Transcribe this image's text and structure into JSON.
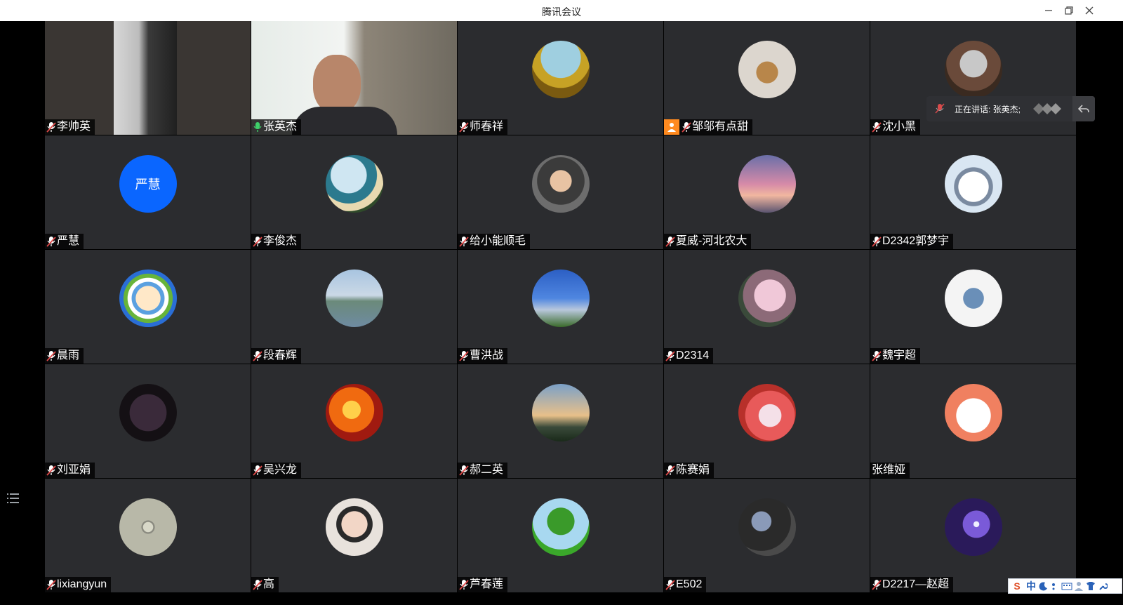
{
  "window": {
    "title": "腾讯会议",
    "controls": [
      "minimize-icon",
      "restore-icon",
      "close-icon"
    ]
  },
  "speaking_indicator": {
    "label": "正在讲话: 张英杰;"
  },
  "participants": [
    {
      "name": "李帅英",
      "mic": "muted",
      "kind": "video"
    },
    {
      "name": "张英杰",
      "mic": "active",
      "kind": "video"
    },
    {
      "name": "师春祥",
      "mic": "muted",
      "kind": "avatar"
    },
    {
      "name": "邹邬有点甜",
      "mic": "muted",
      "kind": "avatar",
      "host": true
    },
    {
      "name": "沈小黑",
      "mic": "muted",
      "kind": "avatar"
    },
    {
      "name": "严慧",
      "mic": "muted",
      "kind": "text-avatar",
      "avatar_text": "严慧"
    },
    {
      "name": "李俊杰",
      "mic": "muted",
      "kind": "avatar"
    },
    {
      "name": "给小能顺毛",
      "mic": "muted",
      "kind": "avatar"
    },
    {
      "name": "夏威-河北农大",
      "mic": "muted",
      "kind": "avatar"
    },
    {
      "name": "D2342郭梦宇",
      "mic": "muted",
      "kind": "avatar"
    },
    {
      "name": "晨雨",
      "mic": "muted",
      "kind": "avatar"
    },
    {
      "name": "段春辉",
      "mic": "muted",
      "kind": "avatar"
    },
    {
      "name": "曹洪战",
      "mic": "muted",
      "kind": "avatar"
    },
    {
      "name": "D2314",
      "mic": "muted",
      "kind": "avatar"
    },
    {
      "name": "魏宇超",
      "mic": "muted",
      "kind": "avatar"
    },
    {
      "name": "刘亚娟",
      "mic": "muted",
      "kind": "avatar"
    },
    {
      "name": "吴兴龙",
      "mic": "muted",
      "kind": "avatar"
    },
    {
      "name": "郝二英",
      "mic": "muted",
      "kind": "avatar"
    },
    {
      "name": "陈赛娟",
      "mic": "muted",
      "kind": "avatar"
    },
    {
      "name": "张维娅",
      "mic": "none",
      "kind": "avatar"
    },
    {
      "name": "lixiangyun",
      "mic": "muted",
      "kind": "avatar"
    },
    {
      "name": "高",
      "mic": "muted",
      "kind": "avatar"
    },
    {
      "name": "芦春莲",
      "mic": "muted",
      "kind": "avatar"
    },
    {
      "name": "E502",
      "mic": "muted",
      "kind": "avatar"
    },
    {
      "name": "D2217—赵超",
      "mic": "muted",
      "kind": "avatar"
    }
  ],
  "ime_toolbar": {
    "items": [
      "S",
      "中"
    ]
  }
}
